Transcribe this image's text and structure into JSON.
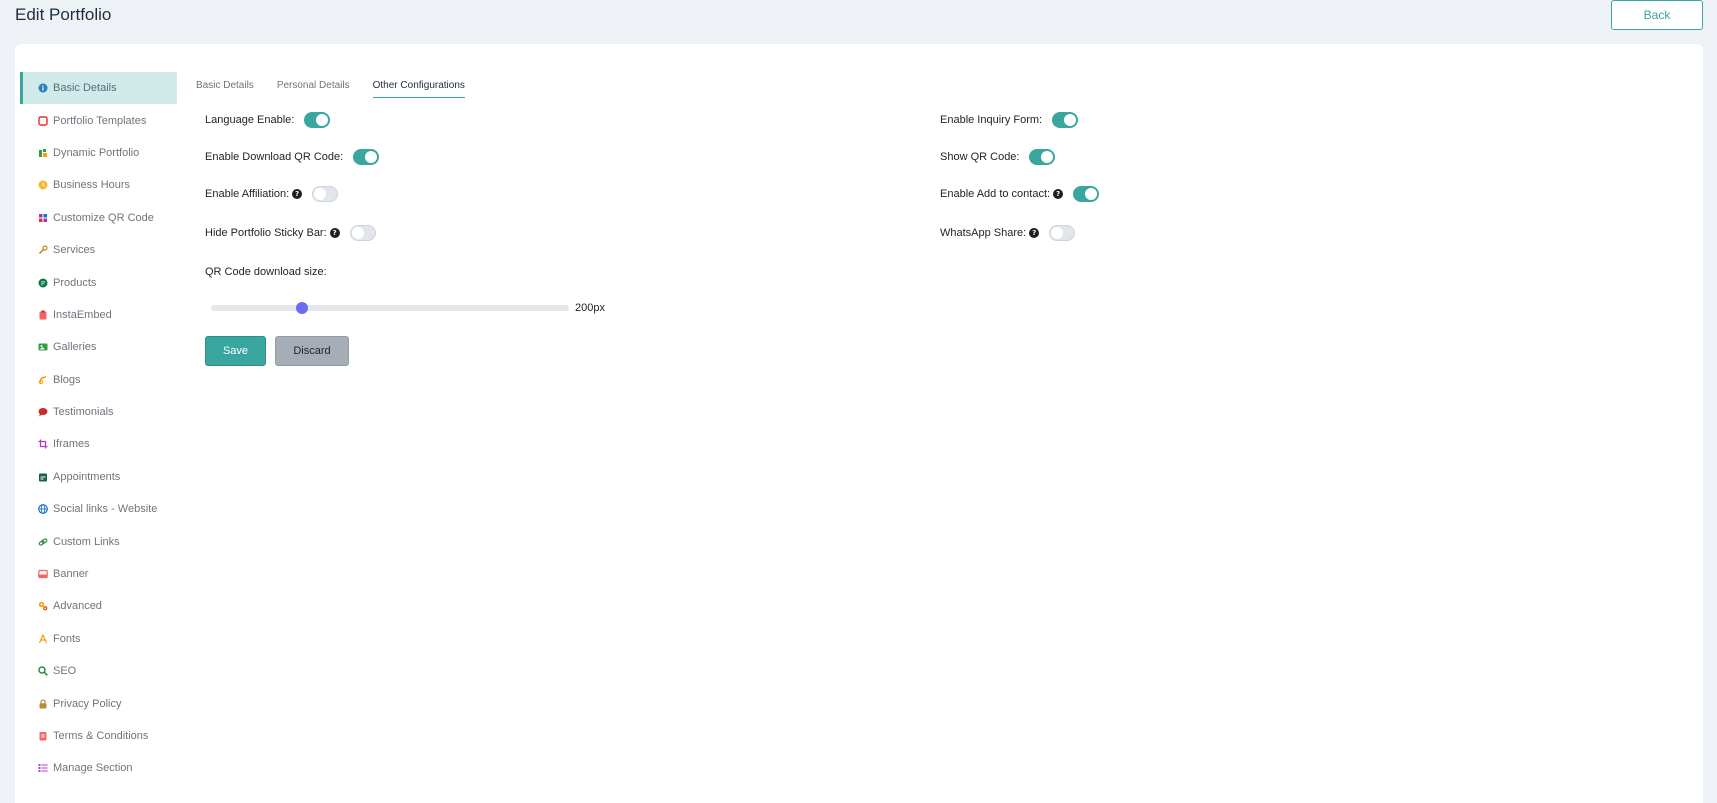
{
  "header": {
    "title": "Edit Portfolio",
    "back_label": "Back"
  },
  "sidebar": {
    "active_index": 0,
    "items": [
      {
        "label": "Basic Details",
        "icon": "info-circle-icon",
        "color": "#2a7fba"
      },
      {
        "label": "Portfolio Templates",
        "icon": "template-icon",
        "color": "#e03131"
      },
      {
        "label": "Dynamic Portfolio",
        "icon": "dynamic-chart-icon",
        "color": "#2f9e44"
      },
      {
        "label": "Business Hours",
        "icon": "clock-icon",
        "color": "#f5b82e"
      },
      {
        "label": "Customize QR Code",
        "icon": "qr-grid-icon",
        "color": "#9c36b5"
      },
      {
        "label": "Services",
        "icon": "wrench-icon",
        "color": "#c28a2b"
      },
      {
        "label": "Products",
        "icon": "product-badge-icon",
        "color": "#0b7a4b"
      },
      {
        "label": "InstaEmbed",
        "icon": "clipboard-icon",
        "color": "#f06565"
      },
      {
        "label": "Galleries",
        "icon": "image-gallery-icon",
        "color": "#2f9e44"
      },
      {
        "label": "Blogs",
        "icon": "blog-link-icon",
        "color": "#f59f00"
      },
      {
        "label": "Testimonials",
        "icon": "speech-bubble-icon",
        "color": "#c92a2a"
      },
      {
        "label": "Iframes",
        "icon": "crop-frame-icon",
        "color": "#ae3ec9"
      },
      {
        "label": "Appointments",
        "icon": "calendar-icon",
        "color": "#1f5f3f"
      },
      {
        "label": "Social links - Website",
        "icon": "globe-icon",
        "color": "#1971c2"
      },
      {
        "label": "Custom Links",
        "icon": "chain-link-icon",
        "color": "#2b8a3e"
      },
      {
        "label": "Banner",
        "icon": "banner-icon",
        "color": "#f06565"
      },
      {
        "label": "Advanced",
        "icon": "gears-icon",
        "color": "#f59f00"
      },
      {
        "label": "Fonts",
        "icon": "font-a-icon",
        "color": "#f59f00"
      },
      {
        "label": "SEO",
        "icon": "magnifier-icon",
        "color": "#2b8a3e"
      },
      {
        "label": "Privacy Policy",
        "icon": "lock-icon",
        "color": "#b88a3a"
      },
      {
        "label": "Terms & Conditions",
        "icon": "document-icon",
        "color": "#f06565"
      },
      {
        "label": "Manage Section",
        "icon": "list-check-icon",
        "color": "#ae3ec9"
      }
    ]
  },
  "tabs": [
    {
      "label": "Basic Details",
      "active": false
    },
    {
      "label": "Personal Details",
      "active": false
    },
    {
      "label": "Other Configurations",
      "active": true
    }
  ],
  "settings": {
    "language_enable": {
      "label": "Language Enable:",
      "on": true,
      "help": false
    },
    "enable_download_qr": {
      "label": "Enable Download QR Code:",
      "on": true,
      "help": false
    },
    "enable_affiliation": {
      "label": "Enable Affiliation:",
      "on": false,
      "help": true
    },
    "hide_sticky_bar": {
      "label": "Hide Portfolio Sticky Bar:",
      "on": false,
      "help": true
    },
    "enable_inquiry": {
      "label": "Enable Inquiry Form:",
      "on": true,
      "help": false
    },
    "show_qr": {
      "label": "Show QR Code:",
      "on": true,
      "help": false
    },
    "enable_add_contact": {
      "label": "Enable Add to contact:",
      "on": true,
      "help": true
    },
    "whatsapp_share": {
      "label": "WhatsApp Share:",
      "on": false,
      "help": true
    }
  },
  "help_glyph": "?",
  "qr_size": {
    "label": "QR Code download size:",
    "value_text": "200px",
    "level": 0.255
  },
  "actions": {
    "save_label": "Save",
    "discard_label": "Discard"
  },
  "colors": {
    "accent": "#3aa6a0",
    "slider_thumb": "#6c6cf0",
    "active_bg": "#cfeae8",
    "discard_bg": "#a7adb7"
  }
}
